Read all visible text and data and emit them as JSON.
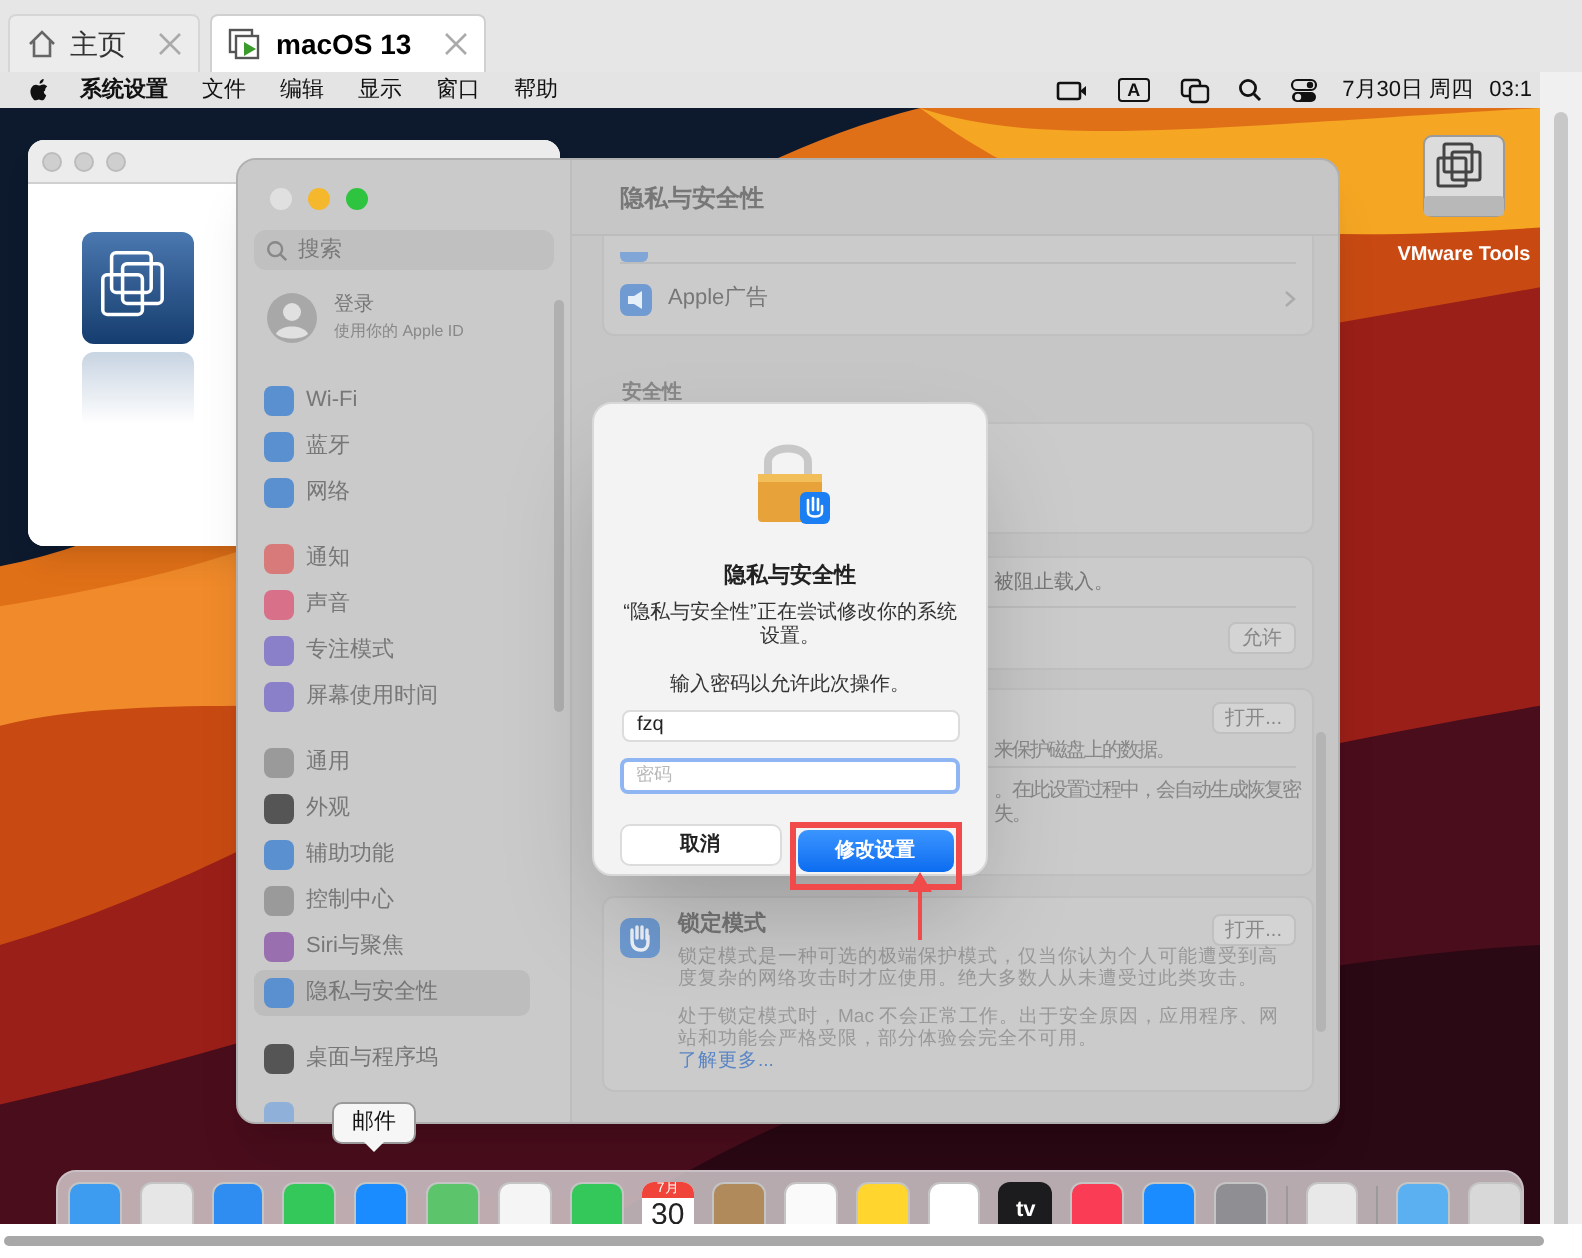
{
  "host_tabs": [
    {
      "label": "主页",
      "kind": "home",
      "selected": false
    },
    {
      "label": "macOS 13",
      "kind": "vm",
      "selected": true
    }
  ],
  "menubar": {
    "app": "系统设置",
    "menus": [
      "文件",
      "编辑",
      "显示",
      "窗口",
      "帮助"
    ],
    "input_key": "A",
    "date": "7月30日 周四",
    "time": "03:1"
  },
  "desktop_icon": {
    "label": "VMware Tools"
  },
  "settings": {
    "search_placeholder": "搜索",
    "account": {
      "title": "登录",
      "subtitle": "使用你的 Apple ID"
    },
    "sidebar_groups": [
      [
        {
          "label": "Wi-Fi",
          "color": "#5a8fd0",
          "selected": false
        },
        {
          "label": "蓝牙",
          "color": "#5a8fd0",
          "selected": false
        },
        {
          "label": "网络",
          "color": "#5a8fd0",
          "selected": false
        }
      ],
      [
        {
          "label": "通知",
          "color": "#d97a7a",
          "selected": false
        },
        {
          "label": "声音",
          "color": "#d9708a",
          "selected": false
        },
        {
          "label": "专注模式",
          "color": "#8a7fc9",
          "selected": false
        },
        {
          "label": "屏幕使用时间",
          "color": "#8a7fc9",
          "selected": false
        }
      ],
      [
        {
          "label": "通用",
          "color": "#9a9a9a",
          "selected": false
        },
        {
          "label": "外观",
          "color": "#555555",
          "selected": false
        },
        {
          "label": "辅助功能",
          "color": "#5a8fd0",
          "selected": false
        },
        {
          "label": "控制中心",
          "color": "#9a9a9a",
          "selected": false
        },
        {
          "label": "Siri与聚焦",
          "color": "#9a6fb0",
          "selected": false
        },
        {
          "label": "隐私与安全性",
          "color": "#5a8fd0",
          "selected": true
        }
      ],
      [
        {
          "label": "桌面与程序坞",
          "color": "#555555",
          "selected": false
        }
      ]
    ],
    "page_title": "隐私与安全性",
    "rows": [
      {
        "label": "Apple广告"
      }
    ],
    "section": "安全性",
    "blocked_text": "被阻止载入。",
    "allow_button": "允许",
    "filevault": {
      "button": "打开...",
      "lines": [
        "来保护磁盘上的数据。",
        "。在此设置过程中，会自动生成恢复密",
        "失。"
      ]
    },
    "lockdown": {
      "title": "锁定模式",
      "button": "打开...",
      "description": "锁定模式是一种可选的极端保护模式，仅当你认为个人可能遭受到高度复杂的网络攻击时才应使用。绝大多数人从未遭受过此类攻击。",
      "note": "处于锁定模式时，Mac 不会正常工作。出于安全原因，应用程序、网站和功能会严格受限，部分体验会完全不可用。",
      "link": "了解更多..."
    }
  },
  "dialog": {
    "title": "隐私与安全性",
    "message": "“隐私与安全性”正在尝试修改你的系统设置。",
    "prompt": "输入密码以允许此次操作。",
    "username": "fzq",
    "password_placeholder": "密码",
    "cancel": "取消",
    "confirm": "修改设置"
  },
  "tooltip": "邮件",
  "dock": [
    {
      "kind": "app",
      "color": "#3d9bf0"
    },
    {
      "kind": "app",
      "color": "#e6e6e6"
    },
    {
      "kind": "app",
      "color": "#2f8cf0"
    },
    {
      "kind": "app",
      "color": "#34c759"
    },
    {
      "kind": "app",
      "color": "#1a8cff"
    },
    {
      "kind": "app",
      "color": "#5cc46b"
    },
    {
      "kind": "app",
      "color": "#f5f5f5"
    },
    {
      "kind": "app",
      "color": "#34c759"
    },
    {
      "kind": "calendar",
      "color": "#ffffff",
      "month": "7月",
      "day": "30"
    },
    {
      "kind": "app",
      "color": "#b08a5a"
    },
    {
      "kind": "app",
      "color": "#fafafa"
    },
    {
      "kind": "app",
      "color": "#ffd52e"
    },
    {
      "kind": "app",
      "color": "#ffffff"
    },
    {
      "kind": "tv",
      "color": "#1c1c1e",
      "label": "tv"
    },
    {
      "kind": "app",
      "color": "#fa3c55"
    },
    {
      "kind": "app",
      "color": "#1a8cff"
    },
    {
      "kind": "app",
      "color": "#8e8e93"
    },
    {
      "kind": "separator"
    },
    {
      "kind": "app",
      "color": "#e8e8e8"
    },
    {
      "kind": "separator"
    },
    {
      "kind": "app",
      "color": "#5ab0f0"
    },
    {
      "kind": "app",
      "color": "#d8d8d8"
    }
  ]
}
